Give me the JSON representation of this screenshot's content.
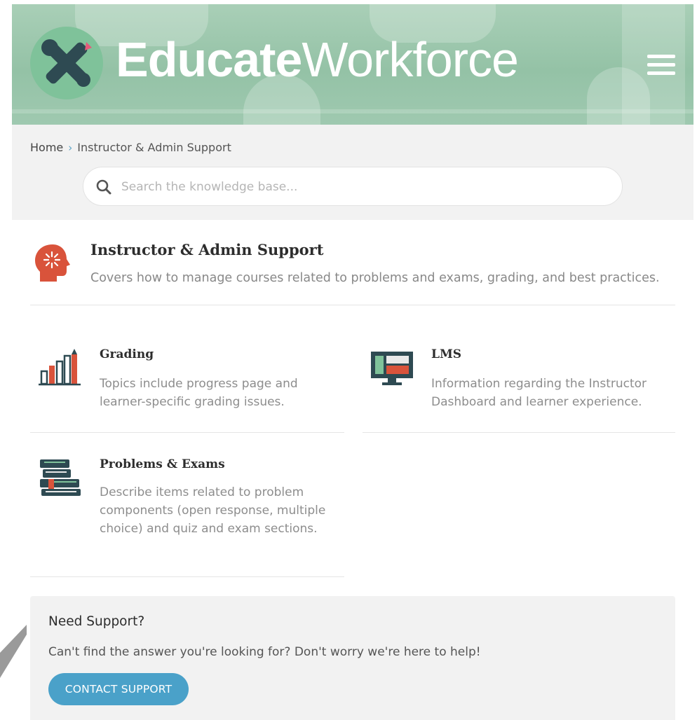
{
  "header": {
    "logo_bold": "Educate",
    "logo_light": "Workforce"
  },
  "breadcrumb": {
    "home": "Home",
    "separator": "›",
    "current": "Instructor & Admin Support"
  },
  "search": {
    "placeholder": "Search the knowledge base...",
    "value": ""
  },
  "category": {
    "icon": "brain-head-icon",
    "title": "Instructor & Admin Support",
    "description": "Covers how to manage courses related to problems and exams, grading, and best practices."
  },
  "subcategories": [
    {
      "icon": "bar-chart-pencil-icon",
      "title": "Grading",
      "description": "Topics include progress page and learner-specific grading issues."
    },
    {
      "icon": "monitor-dashboard-icon",
      "title": "LMS",
      "description": "Information regarding the Instructor Dashboard and learner experience."
    },
    {
      "icon": "book-stack-icon",
      "title": "Problems & Exams",
      "description": "Describe items related to problem components (open response, multiple choice) and quiz and exam sections."
    }
  ],
  "support": {
    "title": "Need Support?",
    "text": "Can't find the answer you're looking for? Don't worry we're here to help!",
    "button": "CONTACT SUPPORT"
  },
  "colors": {
    "header_green": "#94c2a6",
    "accent_blue": "#4aa1c9",
    "icon_red": "#d9533b",
    "icon_dark": "#2e4a52"
  }
}
